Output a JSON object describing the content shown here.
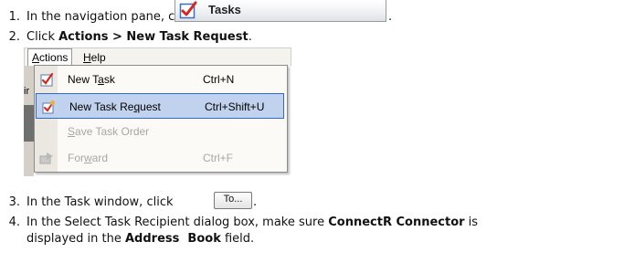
{
  "steps": [
    {
      "num": "1.",
      "pre": "In the navigation pane, click",
      "post": "."
    },
    {
      "num": "2.",
      "pre": "Click ",
      "bold": "Actions > New Task Request",
      "post": "."
    },
    {
      "num": "3.",
      "pre": "In the Task window, click",
      "post": "."
    },
    {
      "num": "4.",
      "pre": "In the Select Task Recipient dialog box, make sure ",
      "bold": "ConnectR Connector",
      "mid": " is",
      "line2_pre": "displayed in the ",
      "line2_bold": "Address  Book",
      "line2_post": " field."
    }
  ],
  "nav_button": {
    "label": "Tasks",
    "icon": "tasks-checkbox-icon"
  },
  "menu": {
    "menubar": [
      {
        "first": "A",
        "rest": "ctions",
        "active": true
      },
      {
        "first": "H",
        "rest": "elp",
        "active": false
      }
    ],
    "background_text": "ir",
    "items": [
      {
        "pre": "New T",
        "ul": "a",
        "post": "sk",
        "shortcut": "Ctrl+N",
        "icon": "new-task-icon",
        "state": "normal"
      },
      {
        "pre": "New Task Re",
        "ul": "q",
        "post": "uest",
        "shortcut": "Ctrl+Shift+U",
        "icon": "new-task-request-icon",
        "state": "highlighted"
      },
      {
        "pre": "",
        "ul": "S",
        "post": "ave Task Order",
        "shortcut": "",
        "icon": "",
        "state": "disabled"
      },
      {
        "pre": "For",
        "ul": "w",
        "post": "ard",
        "shortcut": "Ctrl+F",
        "icon": "forward-icon",
        "state": "disabled"
      }
    ]
  },
  "to_button": {
    "label": "To..."
  },
  "colors": {
    "menu_highlight": "#c1d2ee",
    "menu_highlight_border": "#316ac5",
    "disabled_text": "#a7a7a7",
    "checkmark_red": "#d7261e"
  }
}
